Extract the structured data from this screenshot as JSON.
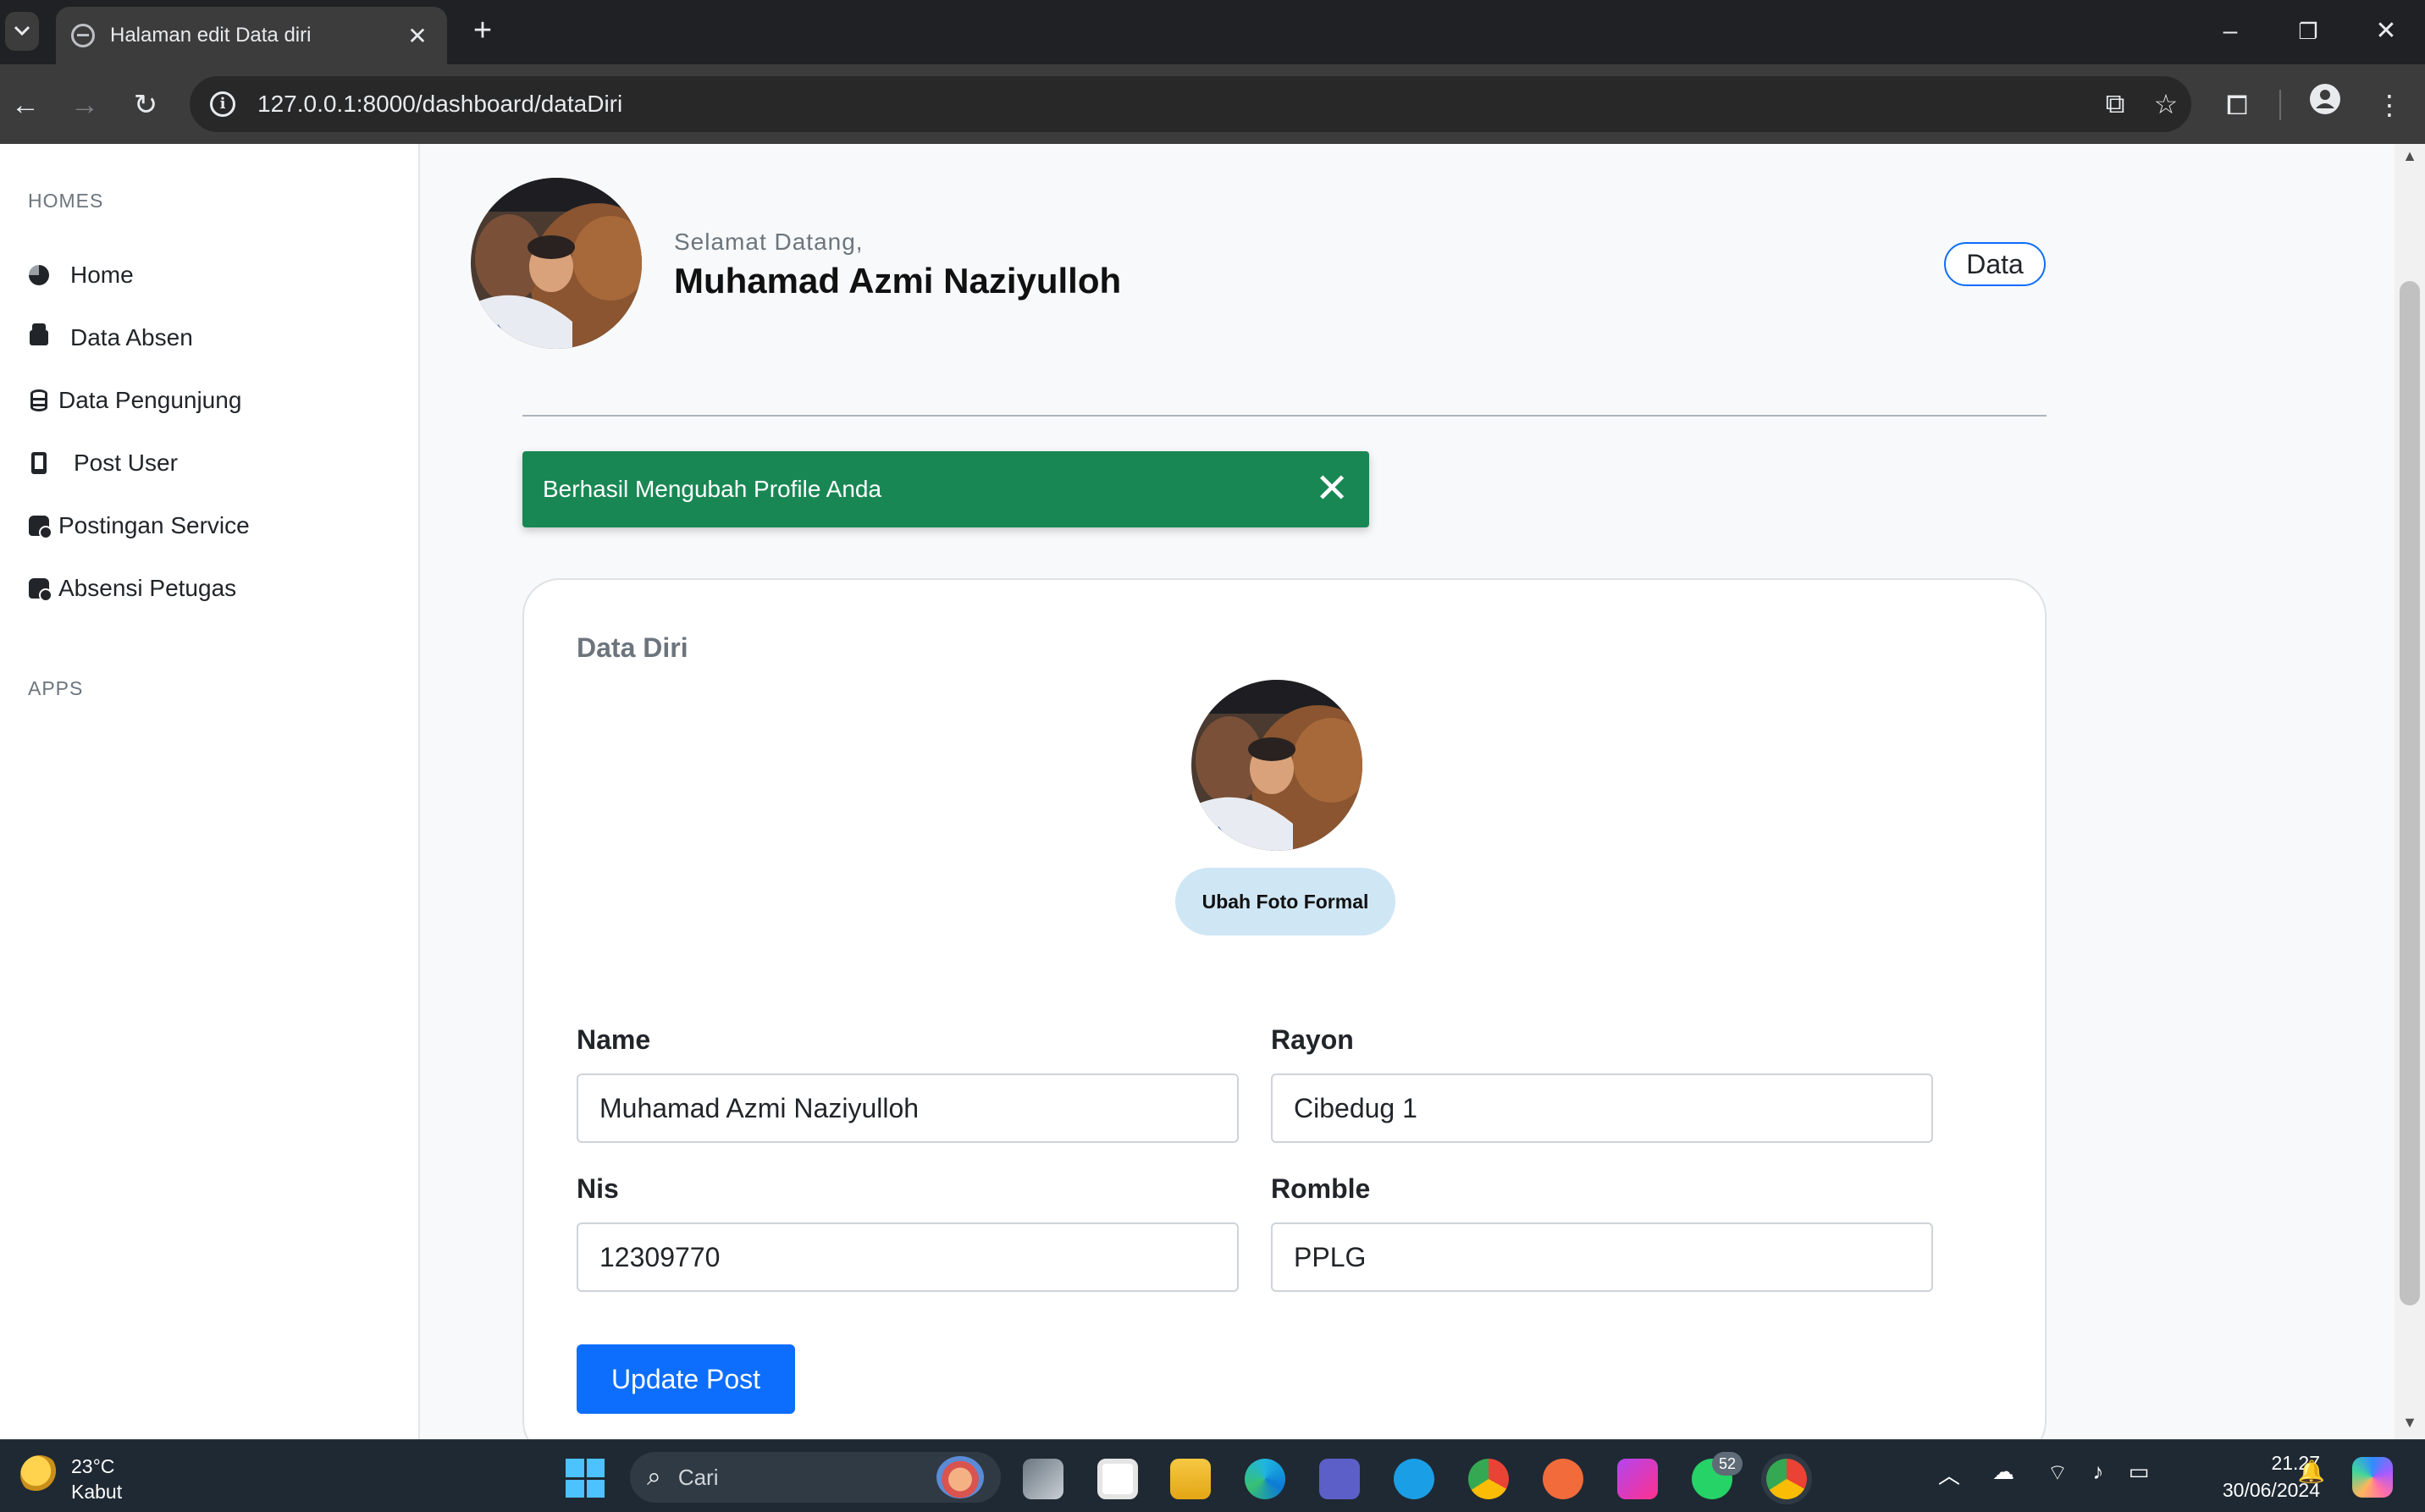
{
  "browser": {
    "tab_title": "Halaman edit Data diri",
    "url": "127.0.0.1:8000/dashboard/dataDiri"
  },
  "sidebar": {
    "sections": [
      {
        "heading": "HOMES",
        "items": [
          {
            "label": "Home",
            "icon": "pie-chart-icon"
          },
          {
            "label": "Data Absen",
            "icon": "inbox-icon"
          },
          {
            "label": "Data Pengunjung",
            "icon": "database-icon"
          },
          {
            "label": "Post User",
            "icon": "phone-icon"
          },
          {
            "label": "Postingan Service",
            "icon": "database-gear-icon"
          },
          {
            "label": "Absensi Petugas",
            "icon": "database-gear-icon"
          }
        ]
      },
      {
        "heading": "APPS",
        "items": []
      }
    ]
  },
  "header": {
    "greeting": "Selamat Datang,",
    "user_name": "Muhamad Azmi Naziyulloh",
    "pill_label": "Data"
  },
  "alert": {
    "message": "Berhasil Mengubah Profile Anda",
    "color": "#198754"
  },
  "card": {
    "title": "Data Diri",
    "photo_button": "Ubah Foto Formal",
    "fields": {
      "name": {
        "label": "Name",
        "value": "Muhamad Azmi Naziyulloh"
      },
      "rayon": {
        "label": "Rayon",
        "value": "Cibedug 1"
      },
      "nis": {
        "label": "Nis",
        "value": "12309770"
      },
      "romble": {
        "label": "Romble",
        "value": "PPLG"
      }
    },
    "submit_label": "Update Post"
  },
  "taskbar": {
    "weather_temp": "23°C",
    "weather_desc": "Kabut",
    "search_placeholder": "Cari",
    "whatsapp_badge": "52",
    "time": "21.27",
    "date": "30/06/2024"
  },
  "colors": {
    "primary": "#0d6efd",
    "success": "#198754"
  }
}
